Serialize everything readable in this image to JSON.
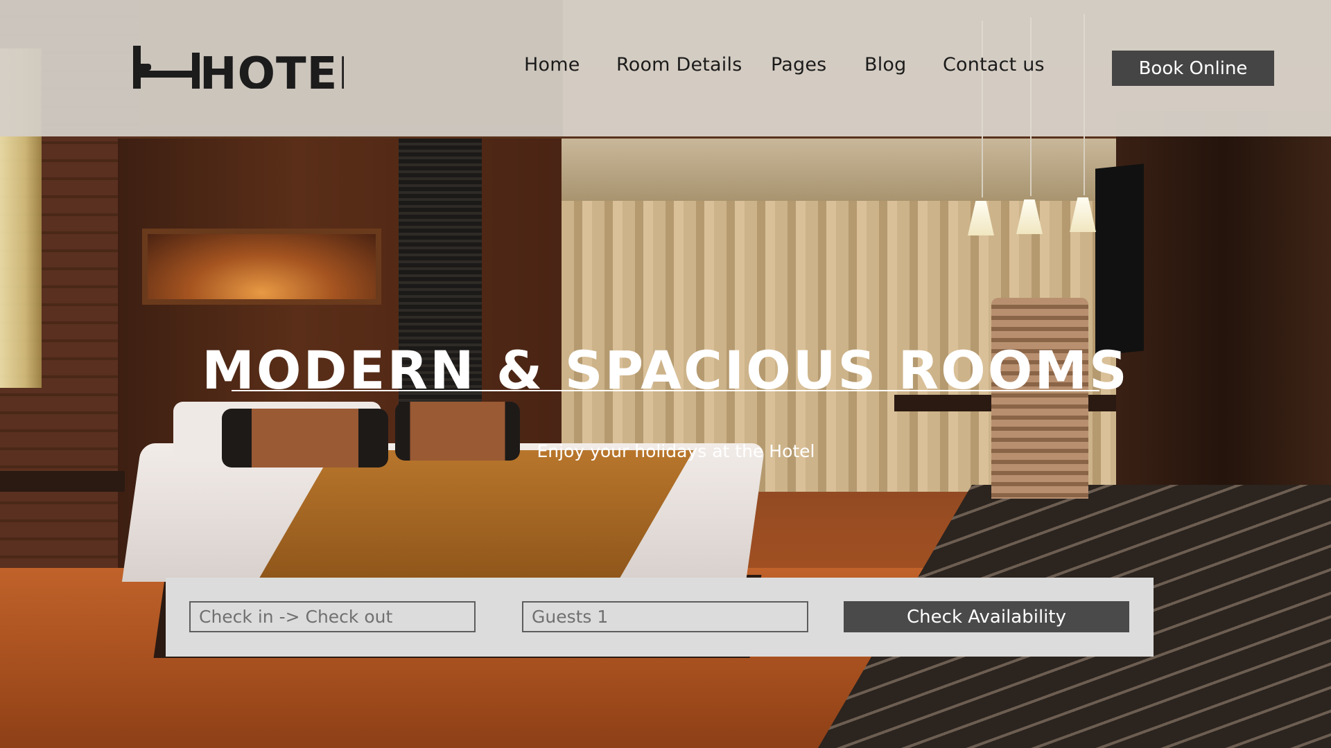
{
  "header": {
    "logo_text": "HOTEL",
    "nav": [
      {
        "label": "Home"
      },
      {
        "label": "Room Details"
      },
      {
        "label": "Pages"
      },
      {
        "label": "Blog"
      },
      {
        "label": "Contact us"
      }
    ],
    "book_label": "Book Online"
  },
  "hero": {
    "title": "MODERN & SPACIOUS ROOMS",
    "subtitle": "Enjoy your holidays at the Hotel"
  },
  "booking": {
    "dates_placeholder": "Check in  -> Check out",
    "guests_placeholder": "Guests 1",
    "check_label": "Check Availability"
  },
  "colors": {
    "header_bg": "#ded8d0",
    "button_dark": "#454545",
    "booking_bg": "#dcdcdc",
    "hero_text": "#ffffff"
  },
  "icons": [
    "bed-icon"
  ]
}
